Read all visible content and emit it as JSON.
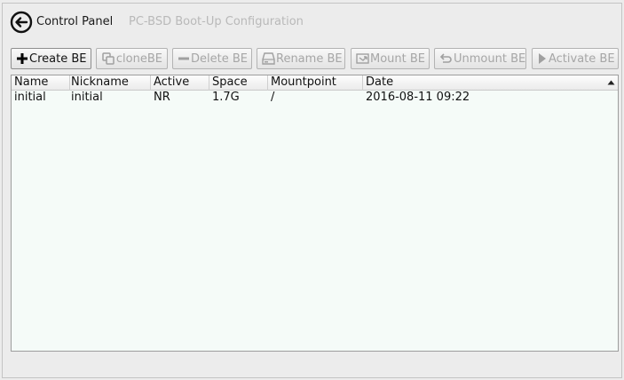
{
  "header": {
    "main_label": "Control Panel",
    "sub_label": "PC-BSD Boot-Up Configuration"
  },
  "toolbar": {
    "create": "Create BE",
    "clone": "cloneBE",
    "delete": "Delete BE",
    "rename": "Rename BE",
    "mount": "Mount BE",
    "unmount": "Unmount BE",
    "activate": "Activate BE"
  },
  "table": {
    "columns": [
      "Name",
      "Nickname",
      "Active",
      "Space",
      "Mountpoint",
      "Date"
    ],
    "rows": [
      [
        "initial",
        "initial",
        "NR",
        "1.7G",
        "/",
        "2016-08-11 09:22"
      ]
    ]
  },
  "colors": {
    "list_background": "#f5fbf8",
    "disabled_text": "#a6a6a6"
  },
  "icons": {
    "back": "back-arrow-circle-icon",
    "create": "plus-icon",
    "clone": "clone-icon",
    "delete": "minus-icon",
    "rename": "drive-icon",
    "mount": "mount-icon",
    "unmount": "unmount-icon",
    "activate": "play-icon",
    "sort": "sort-ascending-icon"
  }
}
